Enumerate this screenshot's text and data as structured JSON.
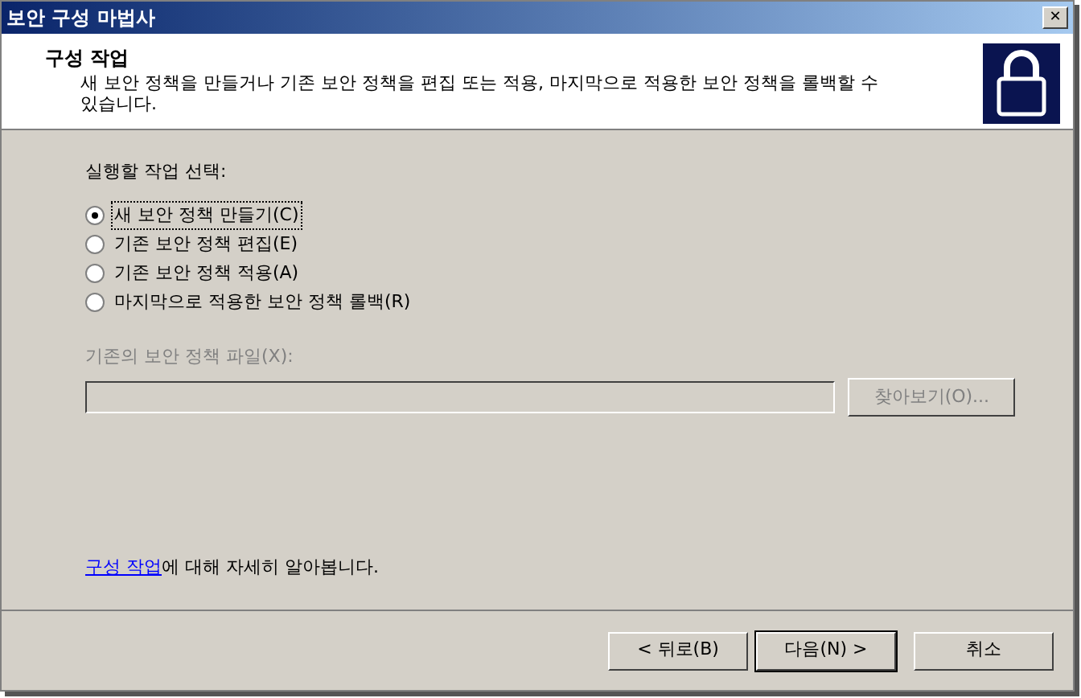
{
  "window": {
    "title": "보안 구성 마법사",
    "close": "✕"
  },
  "header": {
    "title": "구성 작업",
    "description": "새 보안 정책을 만들거나 기존 보안 정책을 편집 또는 적용, 마지막으로 적용한 보안 정책을 롤백할 수 있습니다."
  },
  "task_group": {
    "label": "실행할 작업 선택:",
    "options": [
      {
        "label": "새 보안 정책 만들기(C)",
        "selected": true
      },
      {
        "label": "기존 보안 정책 편집(E)",
        "selected": false
      },
      {
        "label": "기존 보안 정책 적용(A)",
        "selected": false
      },
      {
        "label": "마지막으로 적용한 보안 정책 롤백(R)",
        "selected": false
      }
    ]
  },
  "policy_file": {
    "label": "기존의 보안 정책 파일(X):",
    "disabled": true,
    "browse": "찾아보기(O)..."
  },
  "help": {
    "link": "구성 작업",
    "text": "에 대해 자세히 알아봅니다."
  },
  "buttons": [
    {
      "label": "< 뒤로(B)",
      "default": false
    },
    {
      "label": "다음(N) >",
      "default": true
    },
    {
      "label": "취소",
      "default": false
    }
  ]
}
